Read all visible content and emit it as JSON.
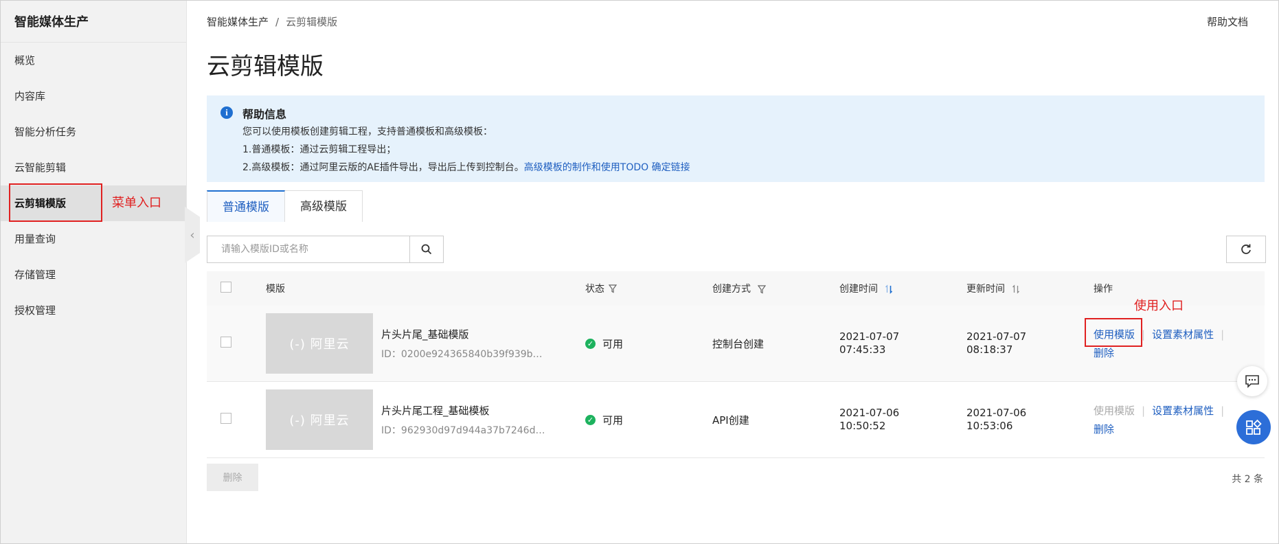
{
  "sidebar": {
    "title": "智能媒体生产",
    "items": [
      {
        "label": "概览",
        "active": false
      },
      {
        "label": "内容库",
        "active": false
      },
      {
        "label": "智能分析任务",
        "active": false
      },
      {
        "label": "云智能剪辑",
        "active": false
      },
      {
        "label": "云剪辑模版",
        "active": true
      },
      {
        "label": "用量查询",
        "active": false
      },
      {
        "label": "存储管理",
        "active": false
      },
      {
        "label": "授权管理",
        "active": false
      }
    ],
    "collapse_icon": "chevron-left-icon"
  },
  "annotations": {
    "menu_entry": "菜单入口",
    "use_entry": "使用入口",
    "color": "#e02020"
  },
  "breadcrumb": {
    "root": "智能媒体生产",
    "separator": "/",
    "current": "云剪辑模版"
  },
  "header": {
    "help_doc": "帮助文档",
    "title": "云剪辑模版"
  },
  "help_box": {
    "icon": "info-icon",
    "title": "帮助信息",
    "line1": "您可以使用模板创建剪辑工程，支持普通模板和高级模板：",
    "line2": "1.普通模板：通过云剪辑工程导出；",
    "line3": "2.高级模板：通过阿里云版的AE插件导出，导出后上传到控制台。",
    "line3_link": "高级模板的制作和使用TODO 确定链接",
    "bg_color": "#e6f2fc"
  },
  "tabs": [
    {
      "label": "普通模版",
      "active": true
    },
    {
      "label": "高级模版",
      "active": false
    }
  ],
  "search": {
    "placeholder": "请输入模版ID或名称",
    "icon": "search-icon"
  },
  "refresh_icon": "refresh-icon",
  "table": {
    "columns": {
      "template": "模版",
      "status": "状态",
      "method": "创建方式",
      "created": "创建时间",
      "updated": "更新时间",
      "ops": "操作"
    },
    "rows": [
      {
        "thumb_text": "(-) 阿里云",
        "name": "片头片尾_基础模版",
        "id": "ID：0200e924365840b39f939b…",
        "status": "可用",
        "method": "控制台创建",
        "created_date": "2021-07-07",
        "created_time": "07:45:33",
        "updated_date": "2021-07-07",
        "updated_time": "08:18:37",
        "op_use": "使用模版",
        "op_use_enabled": true,
        "op_props": "设置素材属性",
        "op_delete": "删除"
      },
      {
        "thumb_text": "(-) 阿里云",
        "name": "片头片尾工程_基础模板",
        "id": "ID：962930d97d944a37b7246d…",
        "status": "可用",
        "method": "API创建",
        "created_date": "2021-07-06",
        "created_time": "10:50:52",
        "updated_date": "2021-07-06",
        "updated_time": "10:53:06",
        "op_use": "使用模版",
        "op_use_enabled": false,
        "op_props": "设置素材属性",
        "op_delete": "删除"
      }
    ]
  },
  "footer": {
    "delete_label": "删除",
    "total": "共 2 条"
  },
  "floating": {
    "chat_icon": "chat-icon",
    "apps_icon": "apps-icon",
    "accent": "#2c6ed8"
  }
}
